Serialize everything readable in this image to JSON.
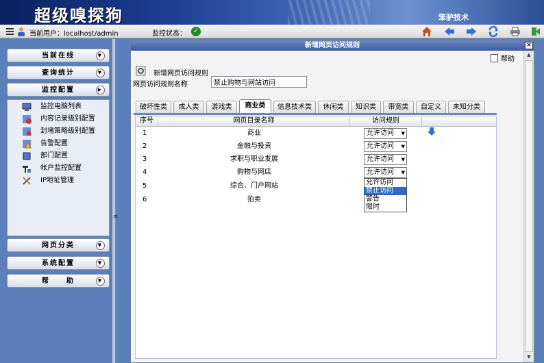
{
  "app": {
    "title": "超级嗅探狗",
    "company": "笨驴技术"
  },
  "status": {
    "user_label": "当前用户：localhost/admin",
    "monitor_label": "监控状态："
  },
  "sidebar": {
    "sections": [
      {
        "label": "当前在线"
      },
      {
        "label": "查询统计"
      },
      {
        "label": "监控配置"
      },
      {
        "label": "网页分类"
      },
      {
        "label": "系统配置"
      },
      {
        "label": "帮　　助"
      }
    ],
    "items": [
      {
        "label": "监控电脑列表"
      },
      {
        "label": "内容记录级别配置"
      },
      {
        "label": "封堵策略级别配置"
      },
      {
        "label": "告警配置"
      },
      {
        "label": "部门配置"
      },
      {
        "label": "帐户监控配置"
      },
      {
        "label": "IP地址管理"
      }
    ]
  },
  "dialog": {
    "title": "新增网页访问规则",
    "help_label": "帮助",
    "heading": "新增网页访问规则",
    "name_label": "网页访问规则名称",
    "name_value": "禁止购物与网站访问",
    "tabs": [
      "破坏性类",
      "成人类",
      "游戏类",
      "商业类",
      "信息技术类",
      "休闲类",
      "知识类",
      "带宽类",
      "自定义",
      "未知分类"
    ],
    "active_tab": "商业类",
    "columns": [
      "序号",
      "网页目录名称",
      "访问规则"
    ],
    "rows": [
      {
        "no": "1",
        "name": "商业",
        "rule": "允许访问"
      },
      {
        "no": "2",
        "name": "金融与投资",
        "rule": "允许访问"
      },
      {
        "no": "3",
        "name": "求职与职业发展",
        "rule": "允许访问"
      },
      {
        "no": "4",
        "name": "购物与网店",
        "rule": "允许访问"
      },
      {
        "no": "5",
        "name": "综合、门户网站",
        "rule": ""
      },
      {
        "no": "6",
        "name": "拍卖",
        "rule": ""
      }
    ],
    "dropdown_options": [
      "允许访问",
      "禁止访问",
      "警告",
      "限时"
    ],
    "dropdown_highlighted": "禁止访问"
  },
  "colors": {
    "accent": "#3e5a9e",
    "sidebar_bg": "#5b7fb8",
    "highlight": "#316ac5",
    "ok_green": "#1e8a2b"
  }
}
